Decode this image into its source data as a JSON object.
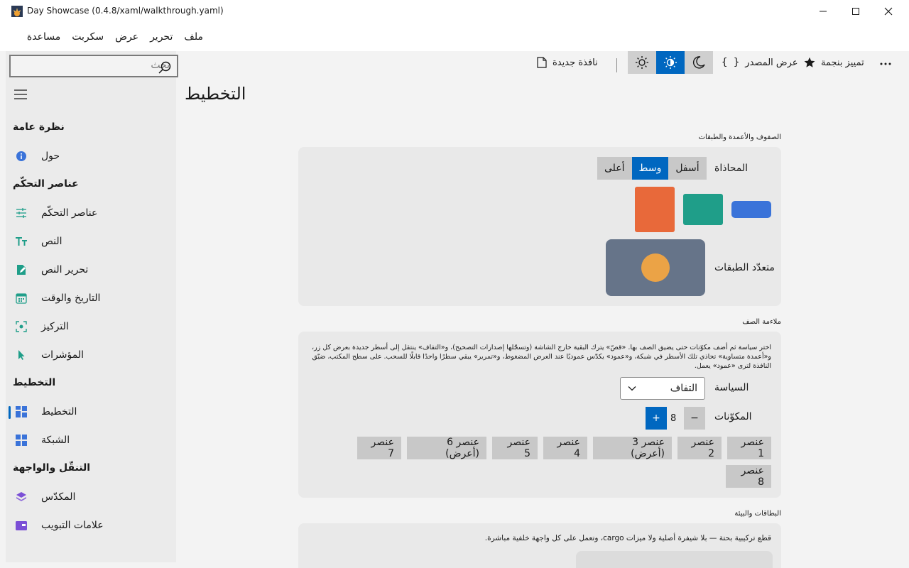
{
  "window": {
    "title": "Day Showcase (0.4.8/xaml/walkthrough.yaml)"
  },
  "menu": [
    "ملف",
    "تحرير",
    "عرض",
    "سكربت",
    "مساعدة"
  ],
  "search": {
    "placeholder": "بحث"
  },
  "toolbar": {
    "new_window": "نافذة جديدة",
    "view_source": "عرض المصدر",
    "highlight_star": "تمييز بنجمة",
    "theme_selected": "auto"
  },
  "sidebar": {
    "sections": [
      {
        "title": "نظرة عامة",
        "items": [
          {
            "label": "حول",
            "icon": "info-icon"
          }
        ]
      },
      {
        "title": "عناصر التحكّم",
        "items": [
          {
            "label": "عناصر التحكّم",
            "icon": "sliders-icon"
          },
          {
            "label": "النص",
            "icon": "text-size-icon"
          },
          {
            "label": "تحرير النص",
            "icon": "edit-icon"
          },
          {
            "label": "التاريخ والوقت",
            "icon": "calendar-icon"
          },
          {
            "label": "التركيز",
            "icon": "focus-icon"
          },
          {
            "label": "المؤشرات",
            "icon": "cursor-icon"
          }
        ]
      },
      {
        "title": "التخطيط",
        "items": [
          {
            "label": "التخطيط",
            "icon": "layout-icon",
            "active": true
          },
          {
            "label": "الشبكة",
            "icon": "grid-icon"
          }
        ]
      },
      {
        "title": "التنقّل والواجهة",
        "items": [
          {
            "label": "المكدّس",
            "icon": "stack-icon"
          },
          {
            "label": "علامات التبويب",
            "icon": "tabs-icon"
          }
        ]
      }
    ]
  },
  "content": {
    "page_title": "التخطيط",
    "rows_section": {
      "label": "الصفوف والأعمدة والطبقات",
      "alignment_label": "المحاذاة",
      "alignment_options": [
        "أسفل",
        "وسط",
        "أعلى"
      ],
      "alignment_selected": "وسط",
      "layers_label": "متعدّد الطبقات"
    },
    "wrap_section": {
      "label": "ملاءمة الصف",
      "description": "اختر سياسة ثم أضف مكوّنات حتى يضيق الصف بها. «قصّ» يترك البقية خارج الشاشة (وتسجّلها إصدارات التصحيح)، و«التفاف» ينتقل إلى أسطر جديدة بعرض كل زر، و«أعمدة متساوية» تحاذي تلك الأسطر في شبكة، و«عمود» يكدّس عموديًا عند العرض المضغوط، و«تمرير» يبقي سطرًا واحدًا قابلًا للسحب. على سطح المكتب، ضيّق النافذة لترى «عمود» يعمل.",
      "policy_label": "السياسة",
      "policy_value": "التفاف",
      "count_label": "المكوّنات",
      "count_value": "8",
      "minus": "−",
      "plus": "+",
      "items": [
        "عنصر 1",
        "عنصر 2",
        "عنصر 3 (أعرض)",
        "عنصر 4",
        "عنصر 5",
        "عنصر 6 (أعرض)",
        "عنصر 7",
        "عنصر 8"
      ]
    },
    "cards_section": {
      "label": "البطاقات والبيئة",
      "description": "قطع تركيبية بحتة — بلا شيفرة أصلية ولا ميزات cargo، وتعمل على كل واجهة خلفية مباشرة."
    }
  },
  "colors": {
    "accent": "#0067c0",
    "orange": "#e8693a",
    "teal": "#1f9e89",
    "blue": "#3a73d9",
    "slate": "#667489",
    "amber": "#eba346"
  }
}
